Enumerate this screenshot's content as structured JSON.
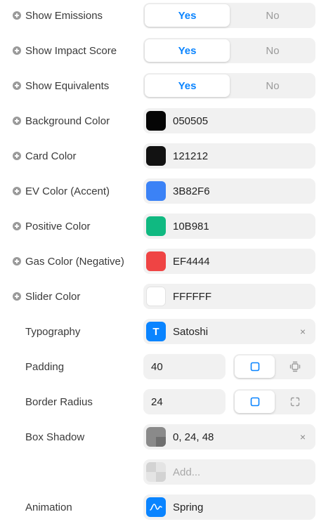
{
  "toggles": [
    {
      "label": "Show Emissions",
      "yes": "Yes",
      "no": "No"
    },
    {
      "label": "Show Impact Score",
      "yes": "Yes",
      "no": "No"
    },
    {
      "label": "Show Equivalents",
      "yes": "Yes",
      "no": "No"
    }
  ],
  "colors": [
    {
      "label": "Background Color",
      "value": "050505",
      "swatch": "#050505"
    },
    {
      "label": "Card Color",
      "value": "121212",
      "swatch": "#121212"
    },
    {
      "label": "EV Color (Accent)",
      "value": "3B82F6",
      "swatch": "#3B82F6"
    },
    {
      "label": "Positive Color",
      "value": "10B981",
      "swatch": "#10B981"
    },
    {
      "label": "Gas Color (Negative)",
      "value": "EF4444",
      "swatch": "#EF4444"
    },
    {
      "label": "Slider Color",
      "value": "FFFFFF",
      "swatch": "#FFFFFF"
    }
  ],
  "typography": {
    "label": "Typography",
    "icon_glyph": "T",
    "value": "Satoshi",
    "clear": "×"
  },
  "padding": {
    "label": "Padding",
    "value": "40"
  },
  "border_radius": {
    "label": "Border Radius",
    "value": "24"
  },
  "box_shadow": {
    "label": "Box Shadow",
    "value": "0, 24, 48",
    "clear": "×",
    "add_placeholder": "Add..."
  },
  "animation": {
    "label": "Animation",
    "value": "Spring"
  },
  "accent": "#0a84ff"
}
